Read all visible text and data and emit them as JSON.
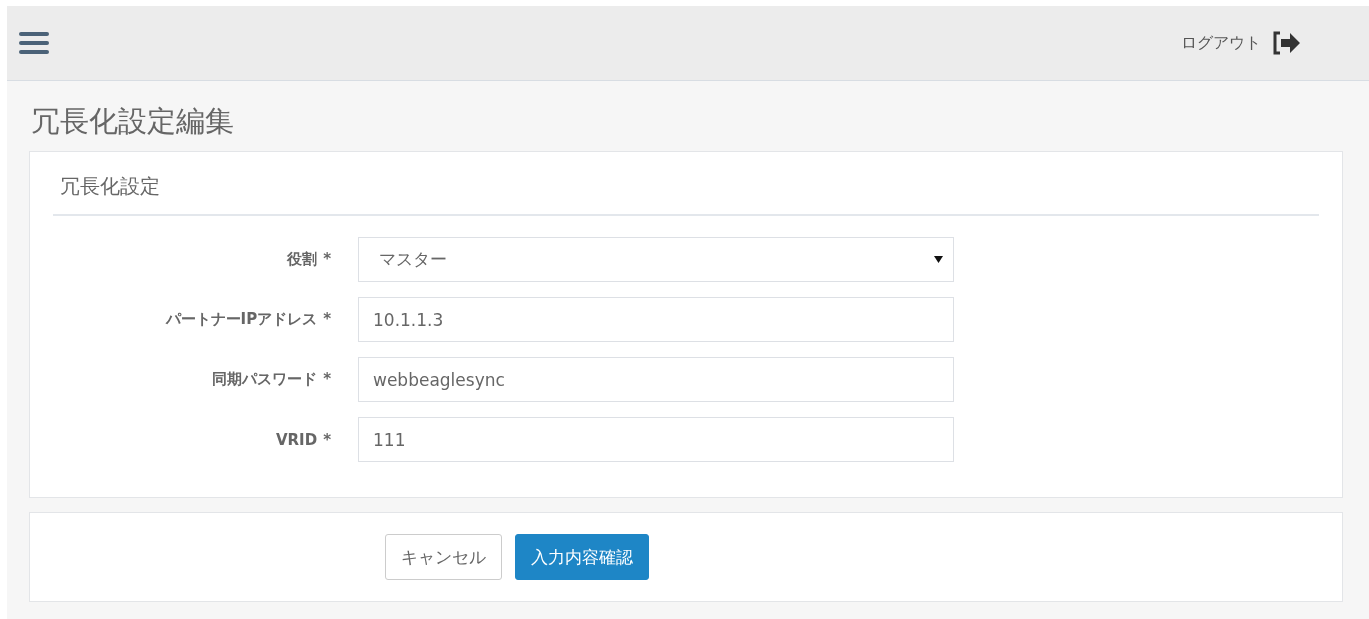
{
  "header": {
    "logout": "ログアウト"
  },
  "page_title": "冗長化設定編集",
  "panel": {
    "title": "冗長化設定",
    "fields": [
      {
        "kind": "select",
        "label": "役割",
        "required_mark": "*",
        "value": "マスター"
      },
      {
        "kind": "input",
        "label": "パートナーIPアドレス",
        "required_mark": "*",
        "value": "10.1.1.3"
      },
      {
        "kind": "input",
        "label": "同期パスワード",
        "required_mark": "*",
        "value": "webbeaglesync"
      },
      {
        "kind": "input",
        "label": "VRID",
        "required_mark": "*",
        "value": "111"
      }
    ]
  },
  "buttons": [
    {
      "kind": "secondary",
      "label": "キャンセル"
    },
    {
      "kind": "primary",
      "label": "入力内容確認"
    }
  ]
}
